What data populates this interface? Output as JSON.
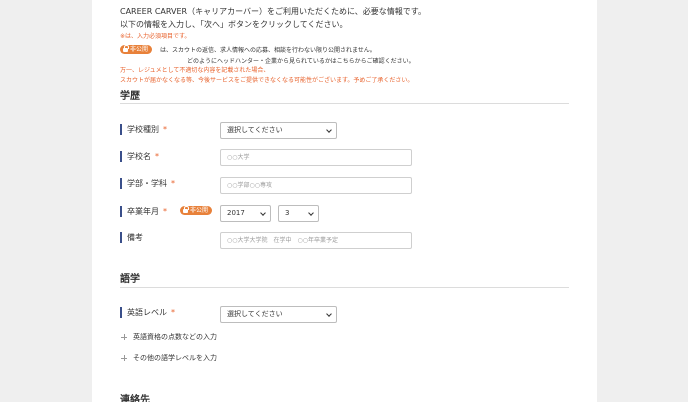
{
  "intro": {
    "line1": "CAREER CARVER（キャリアカーバー）をご利用いただくために、必要な情報です。",
    "line2": "以下の情報を入力し、「次へ」ボタンをクリックしてください。",
    "required_note": "※は、入力必須項目です。"
  },
  "private": {
    "badge_label": "非公開",
    "note_line1": "は、スカウトの返信、求人情報への応募、相談を行わない限り公開されません。",
    "note_line2": "どのようにヘッドハンター・企業から見られているかはこちらからご確認ください。"
  },
  "warning": {
    "line1": "万一、レジュメとして不適切な内容を記載された場合、",
    "line2": "スカウトが届かなくなる等、今後サービスをご提供できなくなる可能性がございます。予めご了承ください。"
  },
  "education": {
    "title": "学歴",
    "school_type": {
      "label": "学校種別",
      "required_mark": "*",
      "value": "選択してください"
    },
    "school_name": {
      "label": "学校名",
      "required_mark": "*",
      "placeholder": "○○大学"
    },
    "faculty": {
      "label": "学部・学科",
      "required_mark": "*",
      "placeholder": "○○学部○○専攻"
    },
    "graduation": {
      "label": "卒業年月",
      "required_mark": "*",
      "badge": "非公開",
      "year": "2017",
      "month": "3"
    },
    "remarks": {
      "label": "備考",
      "placeholder": "○○大学大学院　在学中　○○年卒業予定"
    }
  },
  "language": {
    "title": "語学",
    "english_level": {
      "label": "英語レベル",
      "required_mark": "*",
      "value": "選択してください"
    },
    "expand_scores": "英語資格の点数などの入力",
    "expand_other": "その他の語学レベルを入力"
  },
  "contact": {
    "title": "連絡先"
  }
}
